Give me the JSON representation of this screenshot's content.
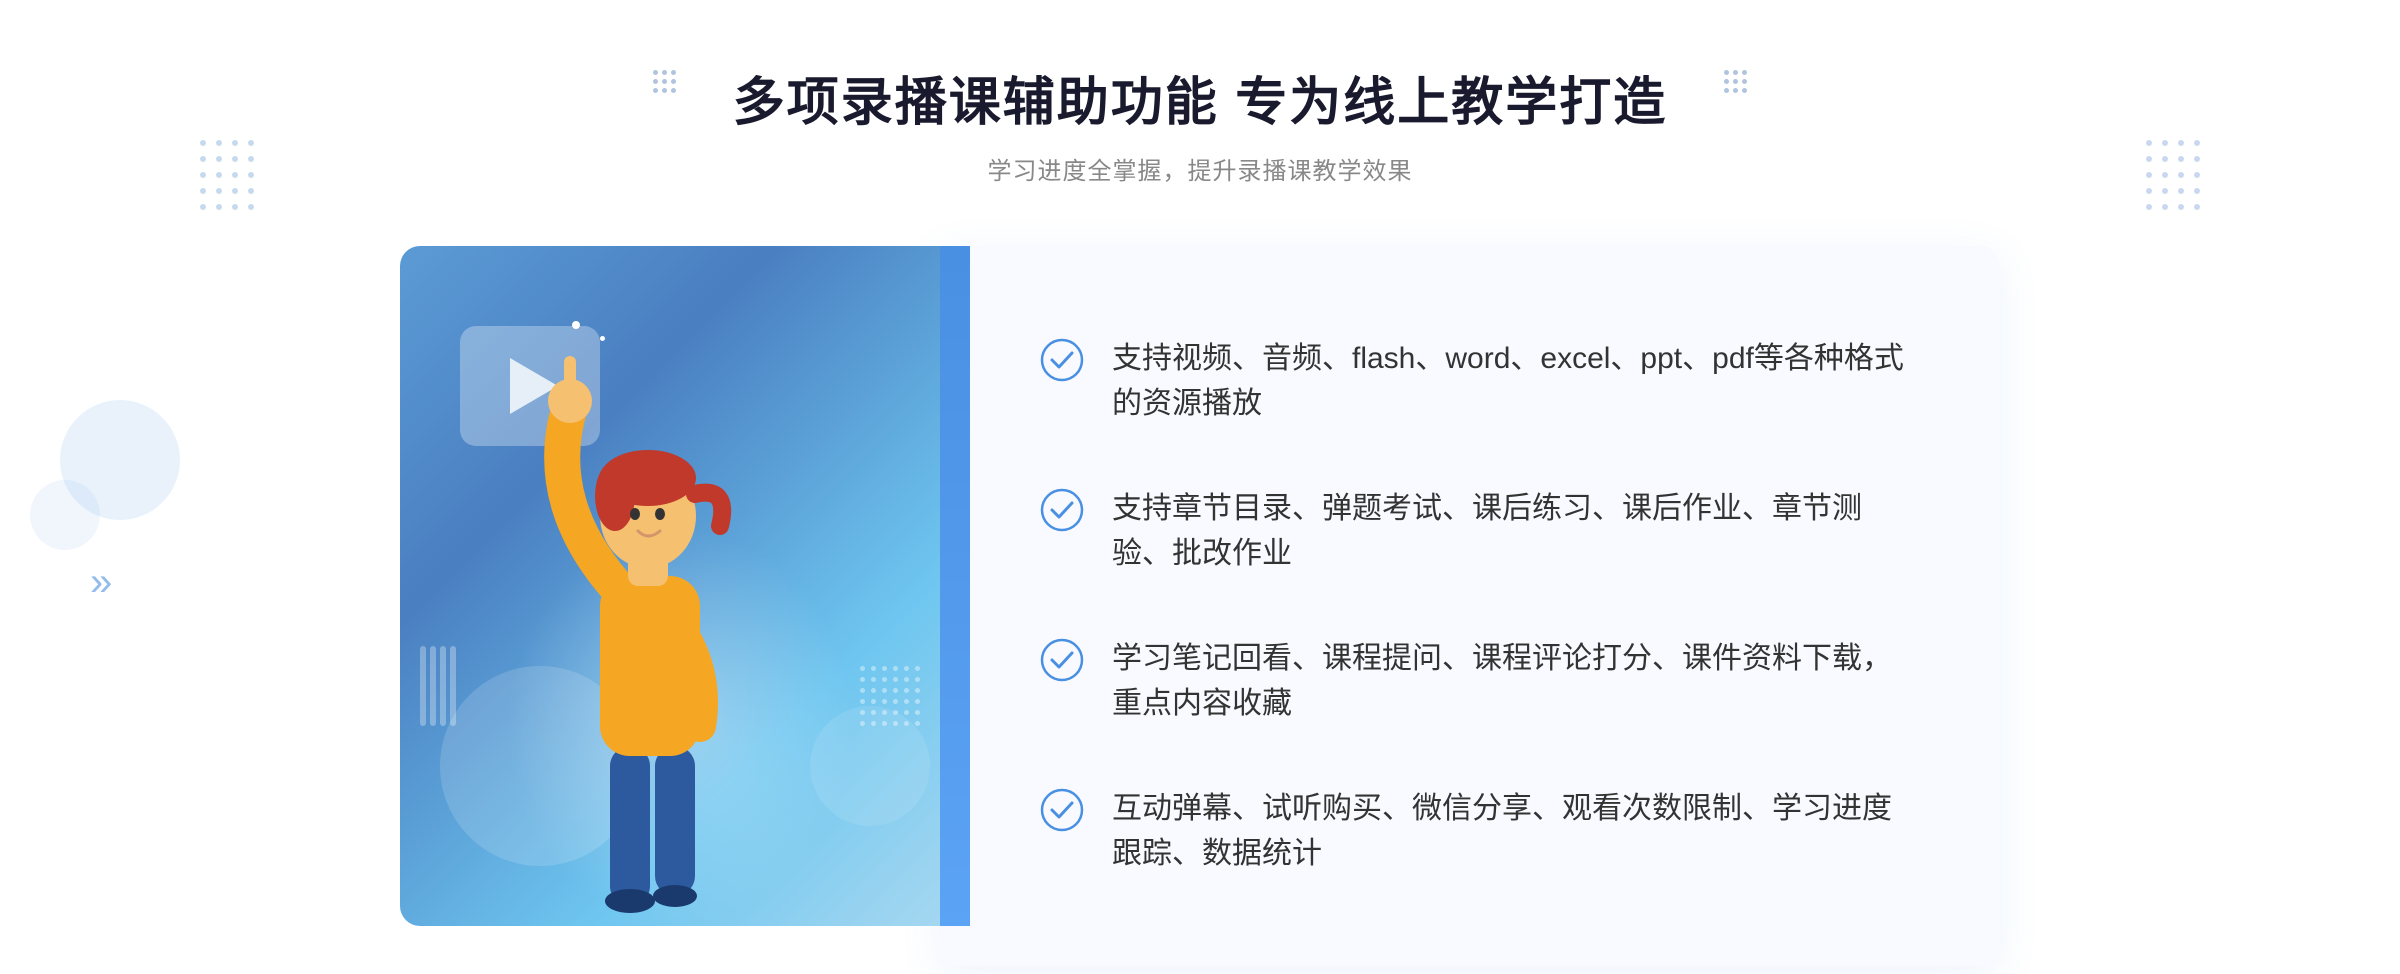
{
  "page": {
    "title": "多项录播课辅助功能 专为线上教学打造",
    "subtitle": "学习进度全掌握，提升录播课教学效果",
    "features": [
      {
        "id": "feature-1",
        "text": "支持视频、音频、flash、word、excel、ppt、pdf等各种格式的资源播放"
      },
      {
        "id": "feature-2",
        "text": "支持章节目录、弹题考试、课后练习、课后作业、章节测验、批改作业"
      },
      {
        "id": "feature-3",
        "text": "学习笔记回看、课程提问、课程评论打分、课件资料下载，重点内容收藏"
      },
      {
        "id": "feature-4",
        "text": "互动弹幕、试听购买、微信分享、观看次数限制、学习进度跟踪、数据统计"
      }
    ],
    "colors": {
      "primary": "#4a90e2",
      "accent": "#5ba3f5",
      "light_blue": "#a8d8f5",
      "text_dark": "#1a1a2e",
      "text_gray": "#888888",
      "bg_panel": "#f8faff"
    }
  }
}
